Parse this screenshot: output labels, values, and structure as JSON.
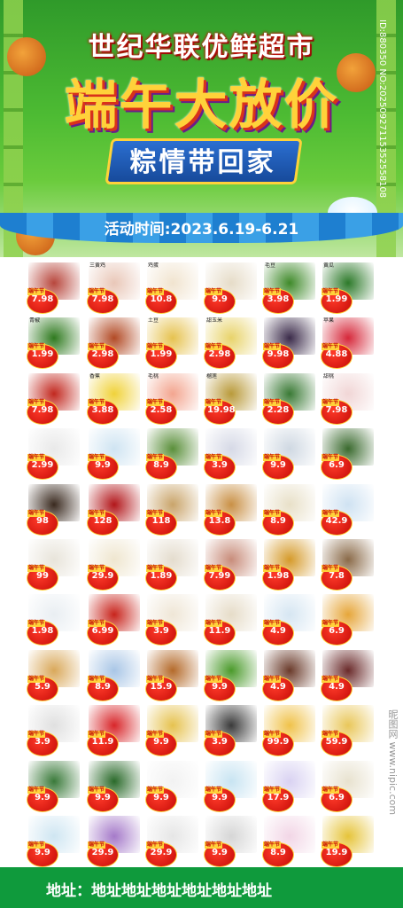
{
  "header": {
    "store_name": "世纪华联优鲜超市",
    "festival_title": "端午大放价",
    "slogan": "粽情带回家",
    "date": "活动时间:2023.6.19-6.21",
    "side_code": "ID:880350 NO:20250927115352558108"
  },
  "price_tag_label": "端午节",
  "rows": [
    [
      {
        "name": "",
        "price": "7.98"
      },
      {
        "name": "三黄鸡",
        "price": "7.98"
      },
      {
        "name": "鸡蛋",
        "price": "10.8"
      },
      {
        "name": "",
        "price": "9.9"
      },
      {
        "name": "毛豆",
        "price": "3.98"
      },
      {
        "name": "黄瓜",
        "price": "1.99"
      }
    ],
    [
      {
        "name": "青椒",
        "price": "1.99"
      },
      {
        "name": "",
        "price": "2.98"
      },
      {
        "name": "土豆",
        "price": "1.99"
      },
      {
        "name": "甜玉米",
        "price": "2.98"
      },
      {
        "name": "",
        "price": "9.98"
      },
      {
        "name": "苹果",
        "price": "4.88"
      }
    ],
    [
      {
        "name": "",
        "price": "7.98"
      },
      {
        "name": "香蕉",
        "price": "3.88"
      },
      {
        "name": "毛桃",
        "price": "2.58"
      },
      {
        "name": "榴莲",
        "price": "19.98"
      },
      {
        "name": "",
        "price": "2.28"
      },
      {
        "name": "甜桃",
        "price": "7.98"
      }
    ],
    [
      {
        "name": "",
        "price": "2.99"
      },
      {
        "name": "",
        "price": "9.9"
      },
      {
        "name": "",
        "price": "8.9"
      },
      {
        "name": "",
        "price": "3.9"
      },
      {
        "name": "",
        "price": "9.9"
      },
      {
        "name": "",
        "price": "6.9"
      }
    ],
    [
      {
        "name": "",
        "price": "98"
      },
      {
        "name": "",
        "price": "128"
      },
      {
        "name": "",
        "price": "118"
      },
      {
        "name": "",
        "price": "13.8"
      },
      {
        "name": "",
        "price": "8.9"
      },
      {
        "name": "",
        "price": "42.9"
      }
    ],
    [
      {
        "name": "",
        "price": "99"
      },
      {
        "name": "",
        "price": "29.9"
      },
      {
        "name": "",
        "price": "1.89"
      },
      {
        "name": "",
        "price": "7.99"
      },
      {
        "name": "",
        "price": "1.98"
      },
      {
        "name": "",
        "price": "7.8"
      }
    ],
    [
      {
        "name": "",
        "price": "1.98"
      },
      {
        "name": "",
        "price": "6.99"
      },
      {
        "name": "",
        "price": "3.9"
      },
      {
        "name": "",
        "price": "11.9"
      },
      {
        "name": "",
        "price": "4.9"
      },
      {
        "name": "",
        "price": "6.9"
      }
    ],
    [
      {
        "name": "",
        "price": "5.9"
      },
      {
        "name": "",
        "price": "8.9"
      },
      {
        "name": "",
        "price": "15.9"
      },
      {
        "name": "",
        "price": "9.9"
      },
      {
        "name": "",
        "price": "4.9"
      },
      {
        "name": "",
        "price": "4.9"
      }
    ],
    [
      {
        "name": "",
        "price": "3.9"
      },
      {
        "name": "",
        "price": "11.9"
      },
      {
        "name": "",
        "price": "9.9"
      },
      {
        "name": "",
        "price": "3.9"
      },
      {
        "name": "",
        "price": "99.9"
      },
      {
        "name": "",
        "price": "59.9"
      }
    ],
    [
      {
        "name": "",
        "price": "9.9"
      },
      {
        "name": "",
        "price": "9.9"
      },
      {
        "name": "",
        "price": "9.9"
      },
      {
        "name": "",
        "price": "9.9"
      },
      {
        "name": "",
        "price": "17.9"
      },
      {
        "name": "",
        "price": "6.9"
      }
    ],
    [
      {
        "name": "",
        "price": "9.9"
      },
      {
        "name": "",
        "price": "29.9"
      },
      {
        "name": "",
        "price": "29.9"
      },
      {
        "name": "",
        "price": "9.9"
      },
      {
        "name": "",
        "price": "8.9"
      },
      {
        "name": "",
        "price": "19.9"
      }
    ]
  ],
  "footer": {
    "address": "地址：地址地址地址地址地址地址"
  },
  "watermark": "昵图网 www.nipic.com",
  "colors": {
    "banner_green": "#4dbb33",
    "price_red": "#c50b07",
    "footer_green": "#0f9a3c",
    "title_gold": "#ffd23a"
  }
}
